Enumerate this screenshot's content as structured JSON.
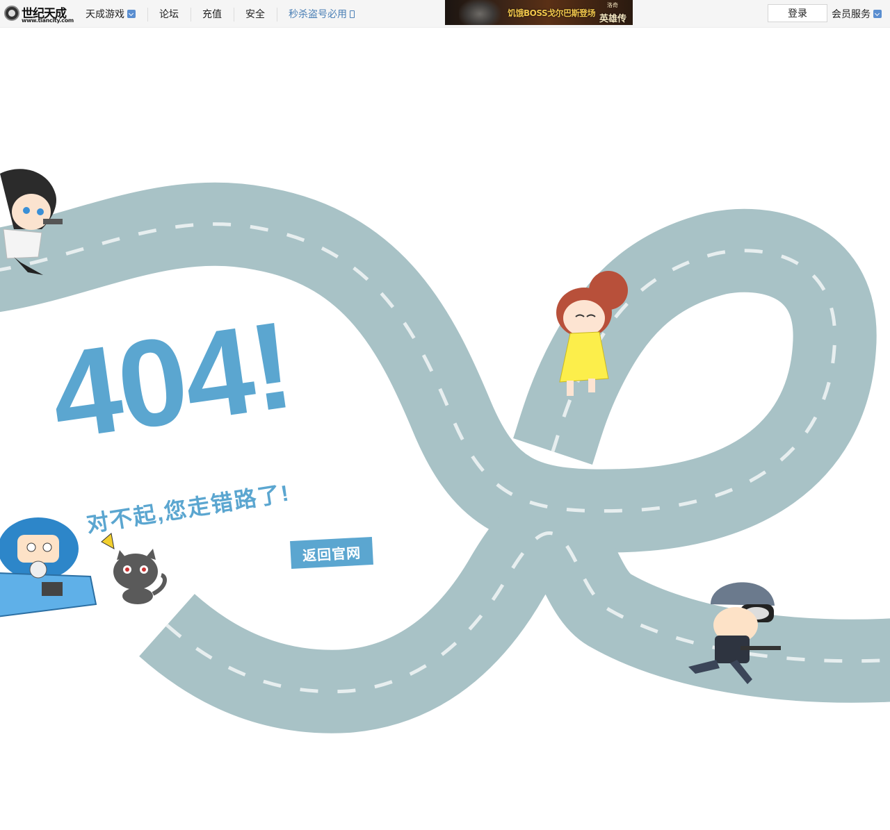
{
  "header": {
    "logo": {
      "name": "世纪天成",
      "url_text": "www.tiancity.com"
    },
    "nav": [
      {
        "label": "天成游戏",
        "icon": "chevron-down-icon"
      },
      {
        "label": "论坛"
      },
      {
        "label": "充值"
      },
      {
        "label": "安全"
      },
      {
        "label": "秒杀盗号必用",
        "icon": "phone-icon"
      }
    ],
    "banner": {
      "text": "饥饿BOSS戈尔巴斯登场",
      "brand": "英雄传",
      "brand_small": "洛奇"
    },
    "login_label": "登录",
    "member_label": "会员服务"
  },
  "error": {
    "code": "404!",
    "message": "对不起,您走错路了!",
    "back_button": "返回官网"
  },
  "colors": {
    "accent": "#5ba6d0",
    "road": "#a8c2c6",
    "road_dash": "#e7eeef",
    "topbar_bg": "#f5f5f5",
    "link_blue": "#4a7fb5"
  },
  "illustrations": [
    "girl-with-gun-character-icon",
    "dancing-girl-character-icon",
    "robot-kart-character-icon",
    "gray-cat-character-icon",
    "soldier-character-icon"
  ]
}
